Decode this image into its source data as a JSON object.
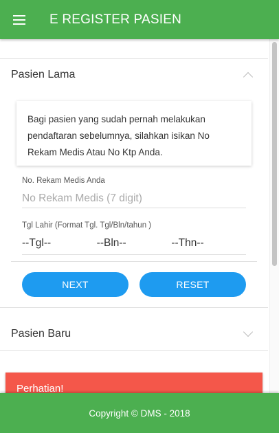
{
  "app": {
    "title": "E REGISTER PASIEN"
  },
  "pasien_lama": {
    "header": "Pasien Lama",
    "info": "Bagi pasien yang sudah pernah melakukan pendaftaran sebelumnya, silahkan isikan No Rekam Medis Atau No Ktp Anda.",
    "rekam_label": "No. Rekam Medis Anda",
    "rekam_placeholder": "No Rekam Medis (7 digit)",
    "tgl_label": "Tgl Lahir (Format Tgl. Tgl/Bln/tahun )",
    "tgl": "--Tgl--",
    "bln": "--Bln--",
    "thn": "--Thn--",
    "next_label": "NEXT",
    "reset_label": "RESET"
  },
  "pasien_baru": {
    "header": "Pasien Baru"
  },
  "alert": {
    "text": "Perhatian!"
  },
  "footer": {
    "text": "Copyright © DMS - 2018"
  },
  "colors": {
    "primary": "#4caf50",
    "button": "#1e9bf0",
    "alert": "#f4574a"
  },
  "icons": {
    "menu": "hamburger-icon",
    "expand": "chevron-up-icon",
    "collapse": "chevron-down-icon"
  }
}
